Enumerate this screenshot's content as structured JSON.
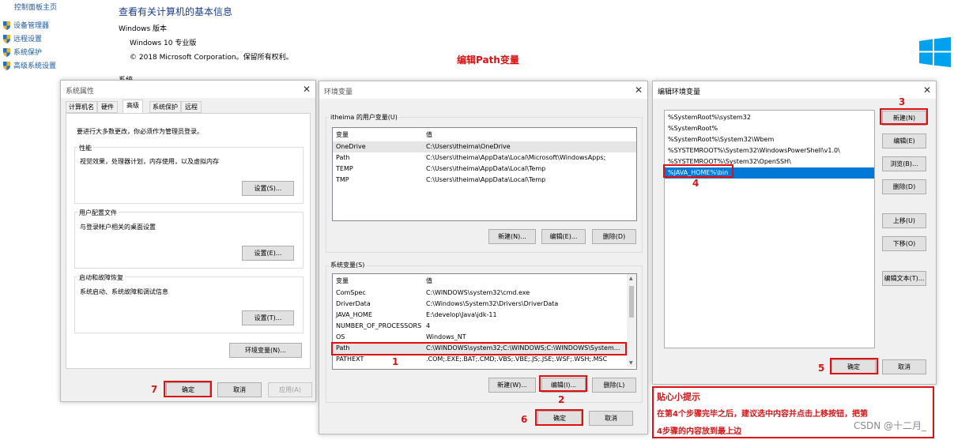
{
  "background": {
    "side_links": [
      "控制面板主页",
      "设备管理器",
      "远程设置",
      "系统保护",
      "高级系统设置"
    ],
    "page_title": "查看有关计算机的基本信息",
    "edition_label": "Windows 版本",
    "edition": "Windows 10 专业版",
    "copyright": "© 2018 Microsoft Corporation。保留所有权利。",
    "system_label": "系统"
  },
  "headline": "编辑Path变量",
  "sysprops": {
    "title": "系统属性",
    "tabs": [
      "计算机名",
      "硬件",
      "高级",
      "系统保护",
      "远程"
    ],
    "admin_note": "要进行大多数更改，你必须作为管理员登录。",
    "perf_label": "性能",
    "perf_desc": "视觉效果，处理器计划，内存使用，以及虚拟内存",
    "perf_btn": "设置(S)...",
    "profile_label": "用户配置文件",
    "profile_desc": "与登录帐户相关的桌面设置",
    "profile_btn": "设置(E)...",
    "startup_label": "启动和故障恢复",
    "startup_desc": "系统启动、系统故障和调试信息",
    "startup_btn": "设置(T)...",
    "env_btn": "环境变量(N)...",
    "ok": "确定",
    "cancel": "取消",
    "apply": "应用(A)"
  },
  "envvars": {
    "title": "环境变量",
    "user_label": "itheima 的用户变量(U)",
    "col_var": "变量",
    "col_val": "值",
    "user_rows": [
      {
        "name": "OneDrive",
        "value": "C:\\Users\\itheima\\OneDrive"
      },
      {
        "name": "Path",
        "value": "C:\\Users\\itheima\\AppData\\Local\\Microsoft\\WindowsApps;"
      },
      {
        "name": "TEMP",
        "value": "C:\\Users\\itheima\\AppData\\Local\\Temp"
      },
      {
        "name": "TMP",
        "value": "C:\\Users\\itheima\\AppData\\Local\\Temp"
      }
    ],
    "user_new": "新建(N)...",
    "user_edit": "编辑(E)...",
    "user_del": "删除(D)",
    "sys_label": "系统变量(S)",
    "sys_rows": [
      {
        "name": "ComSpec",
        "value": "C:\\WINDOWS\\system32\\cmd.exe"
      },
      {
        "name": "DriverData",
        "value": "C:\\Windows\\System32\\Drivers\\DriverData"
      },
      {
        "name": "JAVA_HOME",
        "value": "E:\\develop\\Java\\jdk-11"
      },
      {
        "name": "NUMBER_OF_PROCESSORS",
        "value": "4"
      },
      {
        "name": "OS",
        "value": "Windows_NT"
      },
      {
        "name": "Path",
        "value": "C:\\WINDOWS\\system32;C:\\WINDOWS;C:\\WINDOWS\\System..."
      },
      {
        "name": "PATHEXT",
        "value": ".COM;.EXE;.BAT;.CMD;.VBS;.VBE;.JS;.JSE;.WSF;.WSH;.MSC"
      }
    ],
    "sys_new": "新建(W)...",
    "sys_edit": "编辑(I)...",
    "sys_del": "删除(L)",
    "ok": "确定",
    "cancel": "取消"
  },
  "editenv": {
    "title": "编辑环境变量",
    "entries": [
      "%SystemRoot%\\system32",
      "%SystemRoot%",
      "%SystemRoot%\\System32\\Wbem",
      "%SYSTEMROOT%\\System32\\WindowsPowerShell\\v1.0\\",
      "%SYSTEMROOT%\\System32\\OpenSSH\\",
      "%JAVA_HOME%\\bin"
    ],
    "btn_new": "新建(N)",
    "btn_edit": "编辑(E)",
    "btn_browse": "浏览(B)...",
    "btn_delete": "删除(D)",
    "btn_up": "上移(U)",
    "btn_down": "下移(O)",
    "btn_edittext": "编辑文本(T)...",
    "ok": "确定",
    "cancel": "取消"
  },
  "steps": [
    "1",
    "2",
    "3",
    "4",
    "5",
    "6",
    "7"
  ],
  "tip": {
    "title": "贴心小提示",
    "line1": "在第4个步骤完毕之后，建议选中内容并点击上移按钮，把第",
    "line2": "4步骤的内容放到最上边"
  },
  "watermark": "CSDN @十二月_",
  "colors": {
    "accent_red": "#e01010",
    "selection_blue": "#0078d7",
    "link_blue": "#1a5aa8",
    "windows_logo": "#00a2ed"
  }
}
